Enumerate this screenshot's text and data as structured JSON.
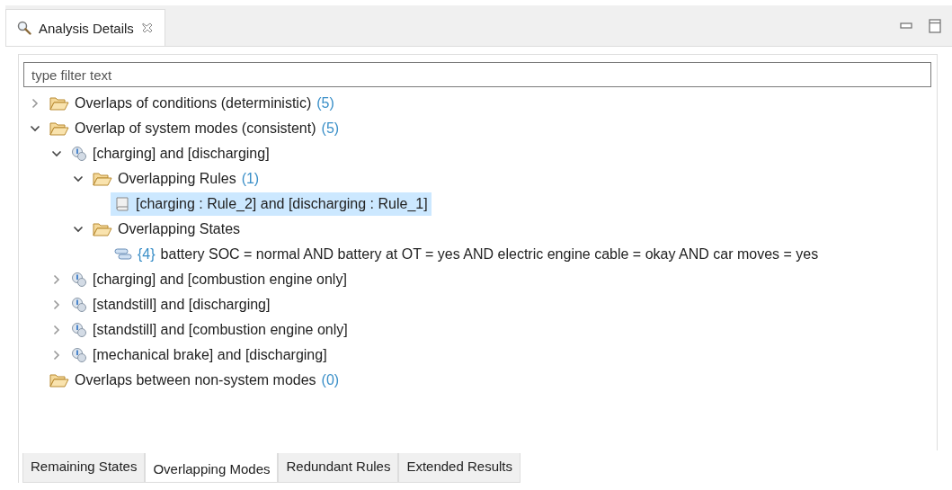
{
  "view_tab": {
    "title": "Analysis Details"
  },
  "filter": {
    "placeholder": "type filter text"
  },
  "tree": [
    {
      "kind": "folder",
      "label": "Overlaps of conditions (deterministic)",
      "count": "(5)",
      "expanded": false,
      "selected": false
    },
    {
      "kind": "folder",
      "label": "Overlap of system modes (consistent)",
      "count": "(5)",
      "expanded": true,
      "selected": false,
      "children": [
        {
          "kind": "pair",
          "label": "[charging] and [discharging]",
          "expanded": true,
          "selected": false,
          "children": [
            {
              "kind": "folder",
              "label": "Overlapping Rules",
              "count": "(1)",
              "expanded": true,
              "selected": false,
              "children": [
                {
                  "kind": "rule",
                  "label": "[charging : Rule_2] and [discharging : Rule_1]",
                  "selected": true
                }
              ]
            },
            {
              "kind": "folder",
              "label": "Overlapping States",
              "expanded": true,
              "selected": false,
              "children": [
                {
                  "kind": "state",
                  "prefix": "{4}",
                  "label": "battery SOC = normal AND battery at OT = yes AND electric engine cable = okay AND car moves = yes",
                  "selected": false
                }
              ]
            }
          ]
        },
        {
          "kind": "pair",
          "label": "[charging] and [combustion engine only]",
          "expanded": false,
          "selected": false
        },
        {
          "kind": "pair",
          "label": "[standstill] and [discharging]",
          "expanded": false,
          "selected": false
        },
        {
          "kind": "pair",
          "label": "[standstill] and [combustion engine only]",
          "expanded": false,
          "selected": false
        },
        {
          "kind": "pair",
          "label": "[mechanical brake] and [discharging]",
          "expanded": false,
          "selected": false
        }
      ]
    },
    {
      "kind": "folder",
      "label": "Overlaps between non-system modes",
      "count": "(0)",
      "selected": false
    }
  ],
  "bottom_tabs": [
    {
      "label": "Remaining States",
      "selected": false
    },
    {
      "label": "Overlapping Modes",
      "selected": true
    },
    {
      "label": "Redundant Rules",
      "selected": false
    },
    {
      "label": "Extended Results",
      "selected": false
    }
  ]
}
